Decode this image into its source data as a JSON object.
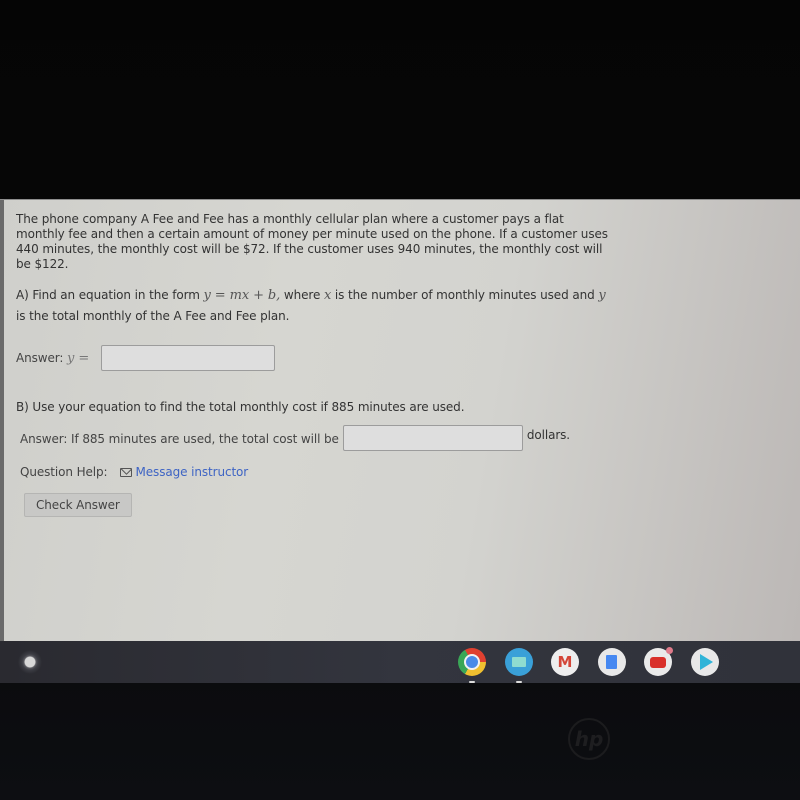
{
  "problem": {
    "text": "The phone company A Fee and Fee has a monthly cellular plan where a customer pays a flat monthly fee and then a certain amount of money per minute used on the phone. If a customer uses 440 minutes, the monthly cost will be $72. If the customer uses 940 minutes, the monthly cost will be $122."
  },
  "part_a": {
    "prefix": "A) Find an equation in the form ",
    "equation": "y = mx + b,",
    "middle": " where ",
    "var_x": "x",
    "middle2": " is the number of monthly minutes used and ",
    "var_y": "y",
    "suffix": " is the total monthly of the A Fee and Fee plan.",
    "answer_label": "Answer: ",
    "answer_var": "y =",
    "answer_value": ""
  },
  "part_b": {
    "question": "B) Use your equation to find the total monthly cost if 885 minutes are used.",
    "answer_label": "Answer: If 885 minutes are used, the total cost will be",
    "answer_value": "",
    "unit": "dollars."
  },
  "help": {
    "label": "Question Help:",
    "link_icon": "mail-icon",
    "link_label": "Message instructor"
  },
  "check_button": {
    "label": "Check Answer"
  },
  "shelf": {
    "launcher_icon": "launcher-icon",
    "apps": [
      {
        "name": "Chrome",
        "icon": "chrome-icon",
        "running": true
      },
      {
        "name": "Files",
        "icon": "files-icon",
        "running": true
      },
      {
        "name": "Gmail",
        "icon": "gmail-icon",
        "glyph": "M",
        "running": false
      },
      {
        "name": "Docs",
        "icon": "docs-icon",
        "running": false
      },
      {
        "name": "YouTube",
        "icon": "youtube-icon",
        "running": false,
        "badge": true
      },
      {
        "name": "Play Store",
        "icon": "play-store-icon",
        "running": false
      }
    ]
  },
  "device": {
    "logo": "hp"
  },
  "colors": {
    "link": "#3e64c4",
    "screen_bg": "#d4d4d0",
    "shelf_bg": "#30323a"
  }
}
